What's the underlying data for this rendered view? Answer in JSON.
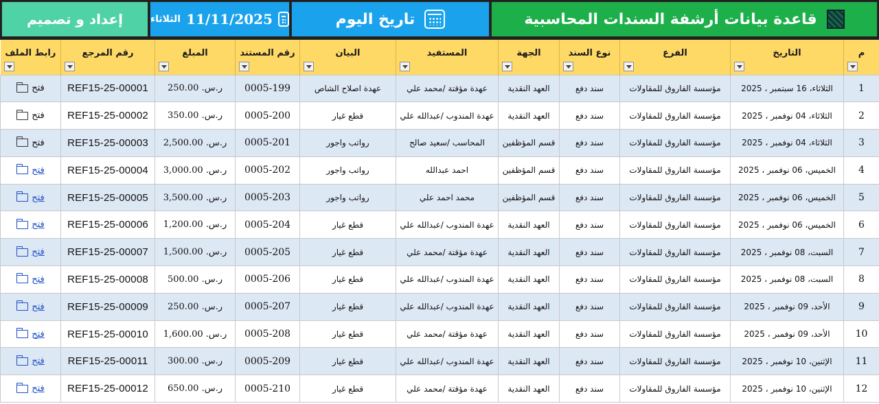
{
  "banner": {
    "title": "قاعدة بيانات أرشفة السندات المحاسبية",
    "today_label": "تاريخ اليوم",
    "day_name": "الثلاثاء",
    "date": "11/11/2025",
    "design": "إعداد و تصميم"
  },
  "columns": [
    "م",
    "التاريخ",
    "الفرع",
    "نوع السند",
    "الجهة",
    "المستفيد",
    "البيان",
    "رقم المستند",
    "المبلغ",
    "رقم المرجع",
    "رابط الملف"
  ],
  "rows": [
    {
      "m": "1",
      "date": "الثلاثاء، 16 سبتمبر ، 2025",
      "branch": "مؤسسة الفاروق للمقاولات",
      "type": "سند دفع",
      "side": "العهد النقدية",
      "beneficiary": "عهدة مؤقتة /محمد علي",
      "statement": "عهدة اصلاح الشاص",
      "doc": "0005-199",
      "amount": "ر.س. 250.00",
      "ref": "REF15-25-00001",
      "link": "فتح"
    },
    {
      "m": "2",
      "date": "الثلاثاء، 04 نوفمبر ، 2025",
      "branch": "مؤسسة الفاروق للمقاولات",
      "type": "سند دفع",
      "side": "العهد النقدية",
      "beneficiary": "عهدة المندوب /عبدالله علي",
      "statement": "قطع غيار",
      "doc": "0005-200",
      "amount": "ر.س. 350.00",
      "ref": "REF15-25-00002",
      "link": "فتح"
    },
    {
      "m": "3",
      "date": "الثلاثاء، 04 نوفمبر ، 2025",
      "branch": "مؤسسة الفاروق للمقاولات",
      "type": "سند دفع",
      "side": "قسم المؤظفين",
      "beneficiary": "المحاسب /سعيد صالح",
      "statement": "رواتب واجور",
      "doc": "0005-201",
      "amount": "ر.س. 2,500.00",
      "ref": "REF15-25-00003",
      "link": "فتح"
    },
    {
      "m": "4",
      "date": "الخميس، 06 نوفمبر ، 2025",
      "branch": "مؤسسة الفاروق للمقاولات",
      "type": "سند دفع",
      "side": "قسم المؤظفين",
      "beneficiary": "احمد عبدالله",
      "statement": "رواتب واجور",
      "doc": "0005-202",
      "amount": "ر.س. 3,000.00",
      "ref": "REF15-25-00004",
      "link": "فتح"
    },
    {
      "m": "5",
      "date": "الخميس، 06 نوفمبر ، 2025",
      "branch": "مؤسسة الفاروق للمقاولات",
      "type": "سند دفع",
      "side": "قسم المؤظفين",
      "beneficiary": "محمد احمد علي",
      "statement": "رواتب واجور",
      "doc": "0005-203",
      "amount": "ر.س. 3,500.00",
      "ref": "REF15-25-00005",
      "link": "فتح"
    },
    {
      "m": "6",
      "date": "الخميس، 06 نوفمبر ، 2025",
      "branch": "مؤسسة الفاروق للمقاولات",
      "type": "سند دفع",
      "side": "العهد النقدية",
      "beneficiary": "عهدة المندوب /عبدالله علي",
      "statement": "قطع غيار",
      "doc": "0005-204",
      "amount": "ر.س. 1,200.00",
      "ref": "REF15-25-00006",
      "link": "فتح"
    },
    {
      "m": "7",
      "date": "السبت، 08 نوفمبر ، 2025",
      "branch": "مؤسسة الفاروق للمقاولات",
      "type": "سند دفع",
      "side": "العهد النقدية",
      "beneficiary": "عهدة مؤقتة /محمد علي",
      "statement": "قطع غيار",
      "doc": "0005-205",
      "amount": "ر.س. 1,500.00",
      "ref": "REF15-25-00007",
      "link": "فتح"
    },
    {
      "m": "8",
      "date": "السبت، 08 نوفمبر ، 2025",
      "branch": "مؤسسة الفاروق للمقاولات",
      "type": "سند دفع",
      "side": "العهد النقدية",
      "beneficiary": "عهدة المندوب /عبدالله علي",
      "statement": "قطع غيار",
      "doc": "0005-206",
      "amount": "ر.س. 500.00",
      "ref": "REF15-25-00008",
      "link": "فتح"
    },
    {
      "m": "9",
      "date": "الأحد، 09 نوفمبر ، 2025",
      "branch": "مؤسسة الفاروق للمقاولات",
      "type": "سند دفع",
      "side": "العهد النقدية",
      "beneficiary": "عهدة المندوب /عبدالله علي",
      "statement": "قطع غيار",
      "doc": "0005-207",
      "amount": "ر.س. 250.00",
      "ref": "REF15-25-00009",
      "link": "فتح"
    },
    {
      "m": "10",
      "date": "الأحد، 09 نوفمبر ، 2025",
      "branch": "مؤسسة الفاروق للمقاولات",
      "type": "سند دفع",
      "side": "العهد النقدية",
      "beneficiary": "عهدة مؤقتة /محمد علي",
      "statement": "قطع غيار",
      "doc": "0005-208",
      "amount": "ر.س. 1,600.00",
      "ref": "REF15-25-00010",
      "link": "فتح"
    },
    {
      "m": "11",
      "date": "الإثنين، 10 نوفمبر ، 2025",
      "branch": "مؤسسة الفاروق للمقاولات",
      "type": "سند دفع",
      "side": "العهد النقدية",
      "beneficiary": "عهدة المندوب /عبدالله علي",
      "statement": "قطع غيار",
      "doc": "0005-209",
      "amount": "ر.س. 300.00",
      "ref": "REF15-25-00011",
      "link": "فتح"
    },
    {
      "m": "12",
      "date": "الإثنين، 10 نوفمبر ، 2025",
      "branch": "مؤسسة الفاروق للمقاولات",
      "type": "سند دفع",
      "side": "العهد النقدية",
      "beneficiary": "عهدة مؤقتة /محمد علي",
      "statement": "قطع غيار",
      "doc": "0005-210",
      "amount": "ر.س. 650.00",
      "ref": "REF15-25-00012",
      "link": "فتح"
    }
  ],
  "colors": {
    "title_bg": "#1db04a",
    "date_bg": "#1aa3ec",
    "design_bg": "#4fd3a6",
    "header_bg": "#ffd966",
    "row_alt_bg": "#dde8f5",
    "link_color": "#1f4fc4"
  },
  "icons": {
    "title": "document-archive-icon",
    "today": "calendar-icon",
    "date": "calendar-icon",
    "link": "folder-open-icon",
    "filter": "filter-dropdown-icon"
  }
}
